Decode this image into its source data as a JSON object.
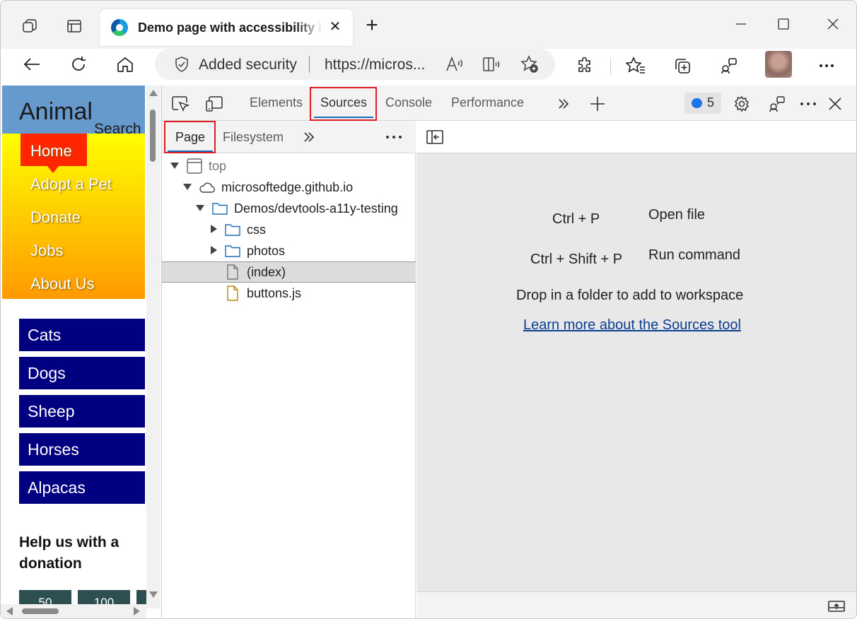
{
  "browser": {
    "tab_title": "Demo page with accessibility issues",
    "address": {
      "security_label": "Added security",
      "url": "https://micros..."
    }
  },
  "webpage": {
    "logo": "Animal",
    "search_label": "Search",
    "nav": [
      "Home",
      "Adopt a Pet",
      "Donate",
      "Jobs",
      "About Us"
    ],
    "categories": [
      "Cats",
      "Dogs",
      "Sheep",
      "Horses",
      "Alpacas"
    ],
    "help_heading": "Help us with a donation",
    "amounts": [
      "50",
      "100"
    ]
  },
  "devtools": {
    "tabs": [
      "Elements",
      "Sources",
      "Console",
      "Performance"
    ],
    "active_tab": "Sources",
    "issues_count": "5",
    "navigator": {
      "tabs": [
        "Page",
        "Filesystem"
      ],
      "active_tab": "Page",
      "tree": [
        {
          "label": "top",
          "depth": 0,
          "state": "expanded",
          "icon": "frame-icon"
        },
        {
          "label": "microsoftedge.github.io",
          "depth": 1,
          "state": "expanded",
          "icon": "cloud-icon"
        },
        {
          "label": "Demos/devtools-a11y-testing",
          "depth": 2,
          "state": "expanded",
          "icon": "folder-icon"
        },
        {
          "label": "css",
          "depth": 3,
          "state": "collapsed",
          "icon": "folder-icon"
        },
        {
          "label": "photos",
          "depth": 3,
          "state": "collapsed",
          "icon": "folder-icon"
        },
        {
          "label": "(index)",
          "depth": 3,
          "state": "leaf",
          "icon": "document-icon",
          "selected": true
        },
        {
          "label": "buttons.js",
          "depth": 3,
          "state": "leaf",
          "icon": "script-file-icon"
        }
      ]
    },
    "editor": {
      "shortcut1_keys": "Ctrl + P",
      "shortcut1_action": "Open file",
      "shortcut2_keys": "Ctrl + Shift + P",
      "shortcut2_action": "Run command",
      "drop_hint": "Drop in a folder to add to workspace",
      "learn_link": "Learn more about the Sources tool"
    }
  },
  "colors": {
    "highlight_border": "#e01b24",
    "accent": "#0f6cbd",
    "page_header": "#6699cc",
    "category_bg": "#000080"
  }
}
